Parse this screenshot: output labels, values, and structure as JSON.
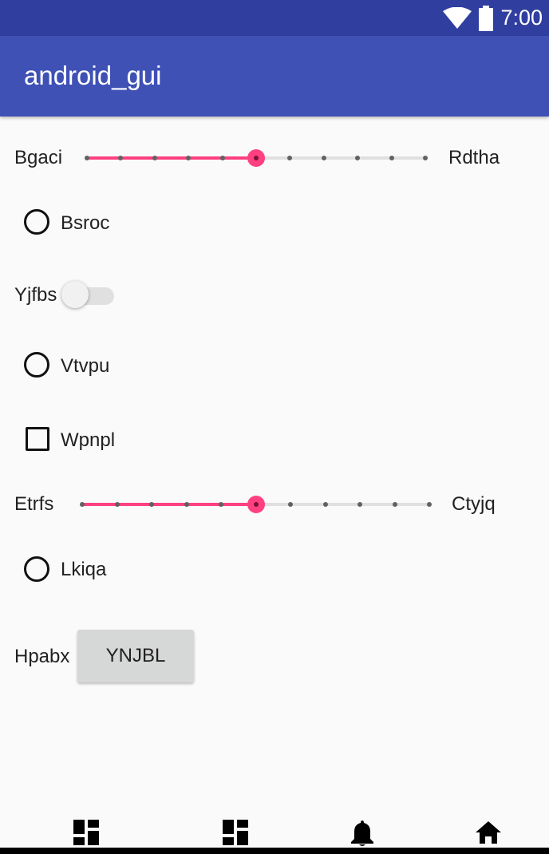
{
  "status_bar": {
    "time": "7:00",
    "icons": [
      "wifi-icon",
      "battery-icon"
    ]
  },
  "app_bar": {
    "title": "android_gui"
  },
  "colors": {
    "primary": "#3f51b5",
    "primary_dark": "#303f9f",
    "accent": "#ff4081"
  },
  "seekbar1": {
    "left_label": "Bgaci",
    "right_label": "Rdtha",
    "value": 5,
    "max": 10
  },
  "radio1": {
    "label": "Bsroc",
    "checked": false
  },
  "switch1": {
    "label": "Yjfbs",
    "on": false
  },
  "radio2": {
    "label": "Vtvpu",
    "checked": false
  },
  "checkbox1": {
    "label": "Wpnpl",
    "checked": false
  },
  "seekbar2": {
    "left_label": "Etrfs",
    "right_label": "Ctyjq",
    "value": 5,
    "max": 10
  },
  "radio3": {
    "label": "Lkiqa",
    "checked": false
  },
  "button_row": {
    "label": "Hpabx",
    "button_text": "YNJBL"
  },
  "bottom_nav": {
    "icons": [
      "dashboard-icon",
      "dashboard-icon",
      "bell-icon",
      "home-icon"
    ]
  }
}
